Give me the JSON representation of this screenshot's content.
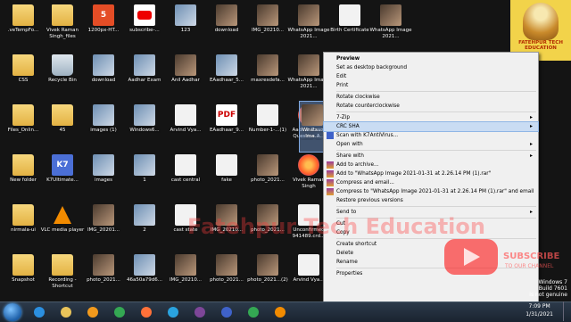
{
  "desktop_icons": [
    {
      "label": ".veTempFo...",
      "type": "folder"
    },
    {
      "label": "Vivek Raman Singh_files",
      "type": "folder"
    },
    {
      "label": "1200px-HT...",
      "type": "html5"
    },
    {
      "label": "subscribe-...",
      "type": "yt"
    },
    {
      "label": "123",
      "type": "img"
    },
    {
      "label": "download",
      "type": "photo"
    },
    {
      "label": "IMG_20210...",
      "type": "photo"
    },
    {
      "label": "WhatsApp Image 2021...",
      "type": "photo"
    },
    {
      "label": "Birth Certificate",
      "type": "doc"
    },
    {
      "label": "WhatsApp Image 2021...",
      "type": "photo"
    },
    {
      "label": "CSS",
      "type": "folder"
    },
    {
      "label": "Recycle Bin",
      "type": "recycle"
    },
    {
      "label": "download",
      "type": "img"
    },
    {
      "label": "Aadhar Exam",
      "type": "img"
    },
    {
      "label": "Anil Aadhar",
      "type": "photo"
    },
    {
      "label": "EAadhaar_5...",
      "type": "img"
    },
    {
      "label": "maxresdefa...",
      "type": "photo"
    },
    {
      "label": "WhatsApp Image 2021...",
      "type": "photo"
    },
    {
      "label": "7z1900",
      "type": "doc"
    },
    {
      "label": "WhatsAp Image 2...",
      "type": "photo"
    },
    {
      "label": "Files_Onlin...",
      "type": "folder"
    },
    {
      "label": "45",
      "type": "folder"
    },
    {
      "label": "images (1)",
      "type": "img"
    },
    {
      "label": "Windows6...",
      "type": "img"
    },
    {
      "label": "Arvind Vya...",
      "type": "doc"
    },
    {
      "label": "EAadhaar_9...",
      "type": "pdf"
    },
    {
      "label": "Number-1-...(1)",
      "type": "doc"
    },
    {
      "label": "Aadhar Exam Question A...",
      "type": "firefox"
    },
    {
      "label": "WhatsApp...",
      "type": "whatsapp"
    },
    {
      "label": "New folder",
      "type": "folder"
    },
    {
      "label": "K7Ultimate...",
      "type": "k7"
    },
    {
      "label": "images",
      "type": "img"
    },
    {
      "label": "1",
      "type": "img"
    },
    {
      "label": "cast central",
      "type": "doc"
    },
    {
      "label": "fake",
      "type": "doc"
    },
    {
      "label": "photo_2021...",
      "type": "photo"
    },
    {
      "label": "Vivek Raman Singh",
      "type": "firefox"
    },
    {
      "label": "Aadhar Card Femal Single",
      "type": "photo"
    },
    {
      "label": "nirmala-ui",
      "type": "folder"
    },
    {
      "label": "VLC media player",
      "type": "vlc"
    },
    {
      "label": "IMG_20201...",
      "type": "photo"
    },
    {
      "label": "2",
      "type": "img"
    },
    {
      "label": "cast state",
      "type": "doc"
    },
    {
      "label": "IMG_20210...",
      "type": "photo"
    },
    {
      "label": "photo_2021...",
      "type": "photo"
    },
    {
      "label": "Unconfirmed 941489.crd...",
      "type": "doc"
    },
    {
      "label": "New folder (2)",
      "type": "folder"
    },
    {
      "label": "Snapshot",
      "type": "folder"
    },
    {
      "label": "Recording - Shortcut",
      "type": "folder"
    },
    {
      "label": "photo_2021...",
      "type": "photo"
    },
    {
      "label": "46a50a79d6...",
      "type": "img"
    },
    {
      "label": "IMG_20210...",
      "type": "photo"
    },
    {
      "label": "photo_2021...",
      "type": "photo"
    },
    {
      "label": "photo_2021...(2)",
      "type": "photo"
    },
    {
      "label": "Arvind Vya...",
      "type": "doc"
    },
    {
      "label": "WhatsApp Image 2021...",
      "type": "photo"
    }
  ],
  "selected_icon_partial_label": "Whats... Ima... 2021-01-3...",
  "channel_logo": {
    "line1": "FATEHPUR TECH",
    "line2": "EDUCATION"
  },
  "context_menu": [
    {
      "label": "Preview",
      "bold": true,
      "submenu": false,
      "icon": ""
    },
    {
      "label": "Set as desktop background",
      "bold": false,
      "submenu": false,
      "icon": ""
    },
    {
      "label": "Edit",
      "bold": false,
      "submenu": false,
      "icon": ""
    },
    {
      "label": "Print",
      "bold": false,
      "submenu": false,
      "icon": ""
    },
    {
      "sep": true
    },
    {
      "label": "Rotate clockwise",
      "bold": false,
      "submenu": false,
      "icon": ""
    },
    {
      "label": "Rotate counterclockwise",
      "bold": false,
      "submenu": false,
      "icon": ""
    },
    {
      "sep": true
    },
    {
      "label": "7-Zip",
      "bold": false,
      "submenu": true,
      "icon": ""
    },
    {
      "label": "CRC SHA",
      "bold": false,
      "submenu": true,
      "icon": "",
      "selected": true
    },
    {
      "label": "Scan with K7AntiVirus...",
      "bold": false,
      "submenu": false,
      "icon": "k7-icon"
    },
    {
      "label": "Open with",
      "bold": false,
      "submenu": true,
      "icon": ""
    },
    {
      "sep": true
    },
    {
      "label": "Share with",
      "bold": false,
      "submenu": true,
      "icon": ""
    },
    {
      "label": "Add to archive...",
      "bold": false,
      "submenu": false,
      "icon": "winrar-icon"
    },
    {
      "label": "Add to \"WhatsApp Image 2021-01-31 at 2.26.14 PM (1).rar\"",
      "bold": false,
      "submenu": false,
      "icon": "winrar-icon"
    },
    {
      "label": "Compress and email...",
      "bold": false,
      "submenu": false,
      "icon": "winrar-icon"
    },
    {
      "label": "Compress to \"WhatsApp Image 2021-01-31 at 2.26.14 PM (1).rar\" and email",
      "bold": false,
      "submenu": false,
      "icon": "winrar-icon"
    },
    {
      "label": "Restore previous versions",
      "bold": false,
      "submenu": false,
      "icon": ""
    },
    {
      "sep": true
    },
    {
      "label": "Send to",
      "bold": false,
      "submenu": true,
      "icon": ""
    },
    {
      "sep": true
    },
    {
      "label": "Cut",
      "bold": false,
      "submenu": false,
      "icon": ""
    },
    {
      "label": "Copy",
      "bold": false,
      "submenu": false,
      "icon": ""
    },
    {
      "sep": true
    },
    {
      "label": "Create shortcut",
      "bold": false,
      "submenu": false,
      "icon": ""
    },
    {
      "label": "Delete",
      "bold": false,
      "submenu": false,
      "icon": ""
    },
    {
      "label": "Rename",
      "bold": false,
      "submenu": false,
      "icon": ""
    },
    {
      "sep": true
    },
    {
      "label": "Properties",
      "bold": false,
      "submenu": false,
      "icon": ""
    }
  ],
  "overlay": {
    "watermark": "Fatehpur Tech Education",
    "subscribe": "SUBSCRIBE",
    "subscribe_sub": "TO OUR CHANNEL"
  },
  "activation": {
    "line1": "Windows 7",
    "line2": "Build 7601",
    "line3": "is not genuine"
  },
  "clock": {
    "time": "7:09 PM",
    "date": "1/31/2021"
  },
  "taskbar_apps": [
    {
      "name": "ie-icon",
      "color": "#2b8fe0"
    },
    {
      "name": "explorer-icon",
      "color": "#e8c35a"
    },
    {
      "name": "media-player-icon",
      "color": "#f29a1d"
    },
    {
      "name": "chrome-icon",
      "color": "#34a853"
    },
    {
      "name": "firefox-icon",
      "color": "#ff7139"
    },
    {
      "name": "telegram-icon",
      "color": "#2aa3df"
    },
    {
      "name": "tor-icon",
      "color": "#7d4698"
    },
    {
      "name": "k7-icon",
      "color": "#3f62c9"
    },
    {
      "name": "chrome-icon",
      "color": "#34a853"
    },
    {
      "name": "vlc-icon",
      "color": "#f28b00"
    }
  ]
}
